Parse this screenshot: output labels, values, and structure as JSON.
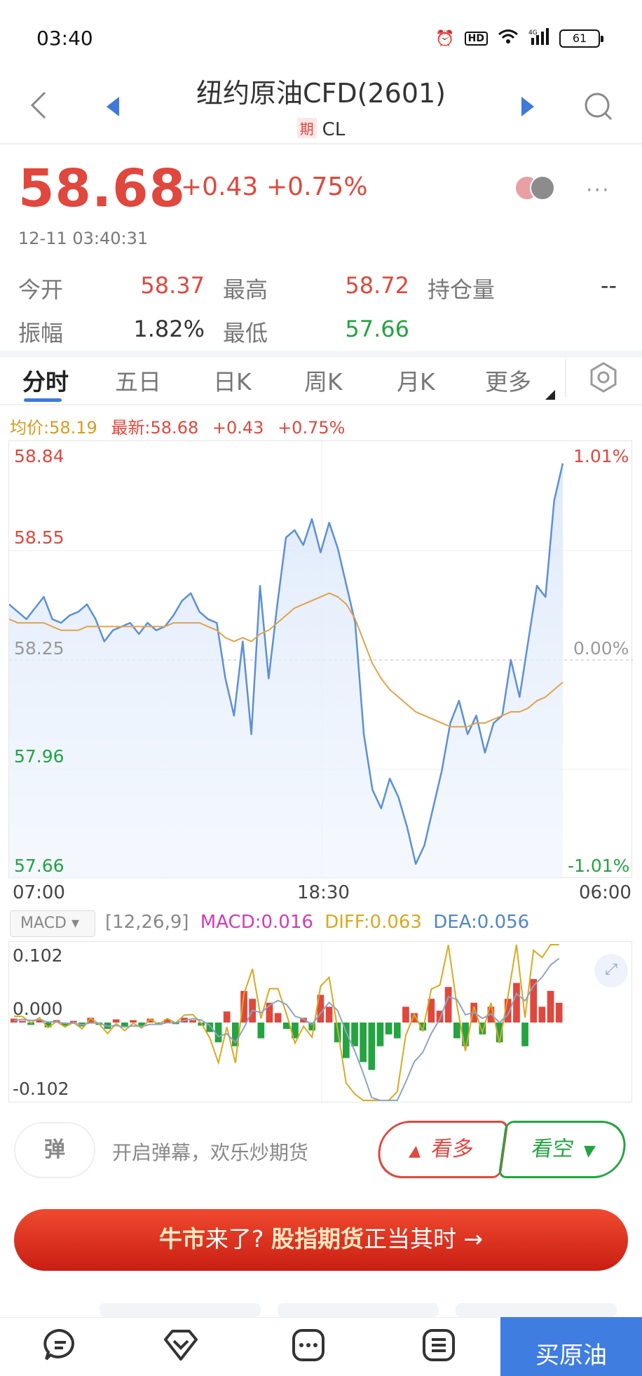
{
  "status_bar": {
    "time": "03:40",
    "hd": "HD",
    "network": "4G",
    "battery": "61"
  },
  "header": {
    "title": "纽约原油CFD(2601)",
    "badge": "期",
    "symbol": "CL"
  },
  "quote": {
    "price": "58.68",
    "change": "+0.43",
    "change_pct": "+0.75%",
    "timestamp": "12-11 03:40:31",
    "stats": [
      {
        "label": "今开",
        "value": "58.37",
        "color": "red"
      },
      {
        "label": "最高",
        "value": "58.72",
        "color": "red"
      },
      {
        "label": "持仓量",
        "value": "--",
        "color": "dark"
      },
      {
        "label": "振幅",
        "value": "1.82%",
        "color": "dark"
      },
      {
        "label": "最低",
        "value": "57.66",
        "color": "green"
      }
    ]
  },
  "tabs": [
    "分时",
    "五日",
    "日K",
    "周K",
    "月K",
    "更多"
  ],
  "chart_info": {
    "avg": "均价:58.19",
    "latest": "最新:58.68",
    "chg": "+0.43",
    "pct": "+0.75%"
  },
  "chart_data": [
    {
      "type": "line",
      "title": "",
      "y_ticks_left": [
        "58.84",
        "58.55",
        "58.25",
        "57.96",
        "57.66"
      ],
      "y_ticks_right": [
        "1.01%",
        "",
        "0.00%",
        "",
        "-1.01%"
      ],
      "x_ticks": [
        "07:00",
        "18:30",
        "06:00"
      ],
      "ylim": [
        57.66,
        58.84
      ],
      "series": [
        {
          "values": [
            58.4,
            58.38,
            58.36,
            58.39,
            58.42,
            58.36,
            58.35,
            58.37,
            58.38,
            58.4,
            58.36,
            58.3,
            58.33,
            58.34,
            58.35,
            58.32,
            58.35,
            58.33,
            58.34,
            58.37,
            58.41,
            58.43,
            58.38,
            58.36,
            58.35,
            58.2,
            58.1,
            58.3,
            58.05,
            58.45,
            58.2,
            58.4,
            58.58,
            58.6,
            58.56,
            58.63,
            58.54,
            58.62,
            58.55,
            58.45,
            58.35,
            58.05,
            57.9,
            57.85,
            57.93,
            57.88,
            57.8,
            57.7,
            57.75,
            57.85,
            57.95,
            58.08,
            58.14,
            58.05,
            58.1,
            58.0,
            58.08,
            58.1,
            58.25,
            58.15,
            58.3,
            58.45,
            58.42,
            58.68,
            58.78
          ]
        },
        {
          "values": [
            58.36,
            58.35,
            58.35,
            58.35,
            58.35,
            58.34,
            58.33,
            58.33,
            58.33,
            58.34,
            58.34,
            58.34,
            58.34,
            58.34,
            58.34,
            58.34,
            58.34,
            58.34,
            58.34,
            58.35,
            58.35,
            58.35,
            58.35,
            58.34,
            58.33,
            58.31,
            58.3,
            58.31,
            58.3,
            58.32,
            58.33,
            58.35,
            58.37,
            58.39,
            58.4,
            58.41,
            58.42,
            58.43,
            58.42,
            58.4,
            58.36,
            58.3,
            58.24,
            58.2,
            58.17,
            58.15,
            58.13,
            58.11,
            58.1,
            58.09,
            58.08,
            58.07,
            58.07,
            58.07,
            58.08,
            58.08,
            58.09,
            58.1,
            58.11,
            58.11,
            58.12,
            58.14,
            58.15,
            58.17,
            58.19
          ]
        }
      ]
    },
    {
      "type": "bar",
      "title": "MACD",
      "y_ticks": [
        "0.102",
        "0.000",
        "-0.102"
      ],
      "ylim": [
        -0.102,
        0.102
      ],
      "macd": {
        "params": "[12,26,9]",
        "macd": "MACD:0.016",
        "diff": "DIFF:0.063",
        "dea": "DEA:0.056"
      },
      "values": [
        0.005,
        0.002,
        -0.003,
        0.004,
        -0.006,
        0.003,
        -0.004,
        0.002,
        -0.005,
        0.006,
        -0.003,
        -0.008,
        0.004,
        -0.006,
        0.003,
        -0.004,
        0.005,
        -0.003,
        0.004,
        -0.002,
        0.006,
        0.003,
        -0.004,
        -0.012,
        -0.025,
        0.014,
        -0.03,
        0.04,
        0.03,
        -0.02,
        0.025,
        0.012,
        -0.008,
        -0.02,
        0.006,
        -0.01,
        0.035,
        0.02,
        -0.025,
        -0.045,
        -0.03,
        -0.05,
        -0.06,
        -0.03,
        -0.015,
        -0.02,
        0.02,
        0.012,
        -0.01,
        0.03,
        0.015,
        0.045,
        -0.02,
        -0.03,
        0.025,
        -0.015,
        0.02,
        -0.025,
        0.03,
        0.05,
        -0.03,
        0.055,
        0.02,
        0.04,
        0.025
      ]
    }
  ],
  "danmu": {
    "icon": "弹",
    "text": "开启弹幕，欢乐炒期货"
  },
  "actions": {
    "bull": "看多",
    "bear": "看空"
  },
  "banner": {
    "part1": "牛市",
    "part2": "来了? ",
    "part3": "股指期货",
    "part4": "正当其时 →"
  },
  "nav": {
    "buy": "买原油"
  },
  "colors": {
    "up": "#e0473d",
    "down": "#23a440",
    "price_line": "#5b8fd9",
    "avg_line": "#e3a24a",
    "accent": "#3f7de0"
  }
}
